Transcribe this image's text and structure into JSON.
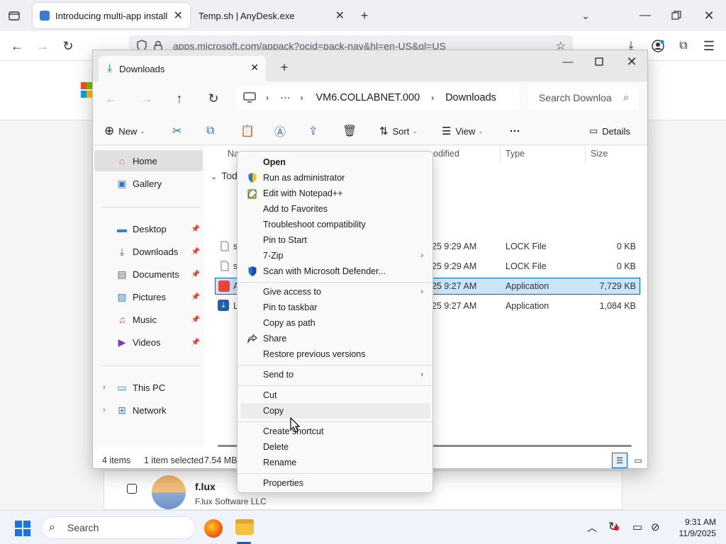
{
  "browser": {
    "tabs": [
      {
        "title": "Introducing multi-app install on",
        "active": true
      },
      {
        "title": "Temp.sh | AnyDesk.exe",
        "active": false
      }
    ],
    "url": "apps.microsoft.com/appack?ocid=pack-nav&hl=en-US&gl=US"
  },
  "web": {
    "card_title": "f.lux",
    "card_publisher": "F.lux Software LLC"
  },
  "explorer": {
    "tab_title": "Downloads",
    "breadcrumb": {
      "more": "···",
      "segments": [
        "VM6.COLLABNET.000",
        "Downloads"
      ]
    },
    "search_placeholder": "Search Downloa",
    "toolbar": {
      "new": "New",
      "sort": "Sort",
      "view": "View",
      "more": "···",
      "details": "Details"
    },
    "nav": {
      "home": "Home",
      "gallery": "Gallery",
      "pinned": [
        "Desktop",
        "Downloads",
        "Documents",
        "Pictures",
        "Music",
        "Videos"
      ],
      "this_pc": "This PC",
      "network": "Network"
    },
    "columns": {
      "name": "Na",
      "modified": "odified",
      "type": "Type",
      "size": "Size"
    },
    "group_label": "Tod",
    "files": [
      {
        "name": "s",
        "modified": "25 9:29 AM",
        "type": "LOCK File",
        "size": "0 KB",
        "selected": false
      },
      {
        "name": "s",
        "modified": "25 9:29 AM",
        "type": "LOCK File",
        "size": "0 KB",
        "selected": false
      },
      {
        "name": "A",
        "modified": "25 9:27 AM",
        "type": "Application",
        "size": "7,729 KB",
        "selected": true
      },
      {
        "name": "L",
        "modified": "25 9:27 AM",
        "type": "Application",
        "size": "1,084 KB",
        "selected": false
      }
    ],
    "status": {
      "items": "4 items",
      "selected": "1 item selected",
      "size": "7.54 MB"
    }
  },
  "context_menu": {
    "items": [
      {
        "label": "Open",
        "bold": true,
        "icon": ""
      },
      {
        "label": "Run as administrator",
        "icon": "shield-icon"
      },
      {
        "label": "Edit with Notepad++",
        "icon": "notepadpp-icon"
      },
      {
        "label": "Add to Favorites",
        "icon": ""
      },
      {
        "label": "Troubleshoot compatibility",
        "icon": ""
      },
      {
        "label": "Pin to Start",
        "icon": ""
      },
      {
        "label": "7-Zip",
        "icon": "",
        "submenu": true
      },
      {
        "label": "Scan with Microsoft Defender...",
        "icon": "defender-icon"
      },
      {
        "label": "Give access to",
        "icon": "",
        "submenu": true
      },
      {
        "label": "Pin to taskbar",
        "icon": ""
      },
      {
        "label": "Copy as path",
        "icon": ""
      },
      {
        "label": "Share",
        "icon": "share-icon"
      },
      {
        "label": "Restore previous versions",
        "icon": ""
      },
      {
        "label": "Send to",
        "icon": "",
        "submenu": true
      },
      {
        "label": "Cut",
        "icon": ""
      },
      {
        "label": "Copy",
        "icon": "",
        "hover": true
      },
      {
        "label": "Create shortcut",
        "icon": ""
      },
      {
        "label": "Delete",
        "icon": ""
      },
      {
        "label": "Rename",
        "icon": ""
      },
      {
        "label": "Properties",
        "icon": ""
      }
    ]
  },
  "taskbar": {
    "search_label": "Search",
    "time": "9:31 AM",
    "date": "11/9/2025"
  },
  "colors": {
    "accent": "#0067c0",
    "selection": "#cce4f7",
    "menu_bg": "#f9f9f9"
  }
}
